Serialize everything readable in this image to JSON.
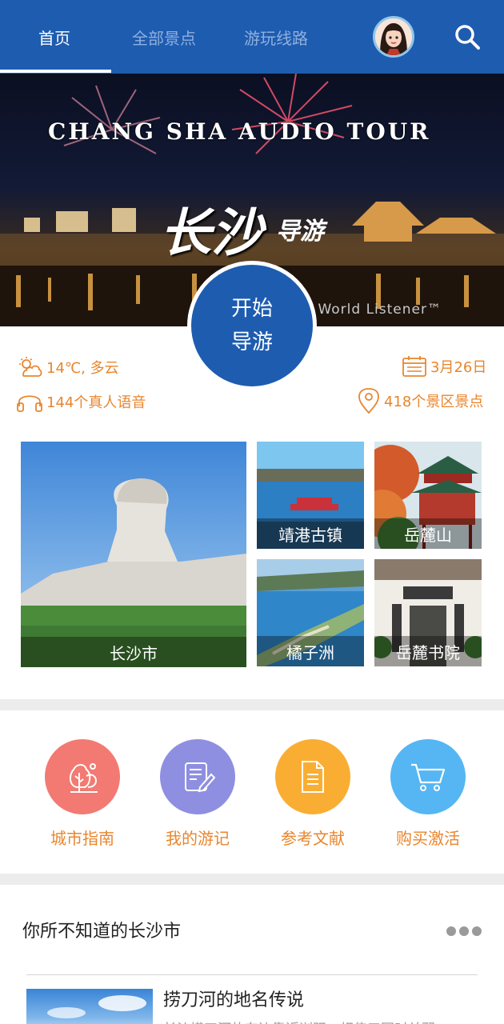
{
  "nav": {
    "tabs": [
      {
        "label": "首页",
        "active": true
      },
      {
        "label": "全部景点",
        "active": false
      },
      {
        "label": "游玩线路",
        "active": false
      }
    ]
  },
  "banner": {
    "title": "CHANG SHA AUDIO TOUR",
    "calligraphy": "长沙",
    "calligraphy_sub": "导游",
    "credit": "y World Listener™"
  },
  "start_button": {
    "line1": "开始",
    "line2": "导游"
  },
  "info": {
    "weather": "14℃, 多云",
    "date": "3月26日",
    "voice_count": "144个真人语音",
    "spot_count": "418个景区景点"
  },
  "tiles": [
    {
      "label": "长沙市"
    },
    {
      "label": "靖港古镇"
    },
    {
      "label": "岳麓山"
    },
    {
      "label": "橘子洲"
    },
    {
      "label": "岳麓书院"
    }
  ],
  "features": [
    {
      "label": "城市指南",
      "icon": "city-guide-icon",
      "color": "#f27a72"
    },
    {
      "label": "我的游记",
      "icon": "travel-notes-icon",
      "color": "#8e8fe0"
    },
    {
      "label": "参考文献",
      "icon": "document-icon",
      "color": "#f9ae33"
    },
    {
      "label": "购买激活",
      "icon": "cart-icon",
      "color": "#55b6f3"
    }
  ],
  "section": {
    "title": "你所不知道的长沙市"
  },
  "article": {
    "title": "捞刀河的地名传说",
    "desc": "长沙捞刀河的东边靠近浏阳，相传三国时关羽..."
  },
  "colors": {
    "primary": "#1e5cb0",
    "accent": "#e8862e"
  }
}
